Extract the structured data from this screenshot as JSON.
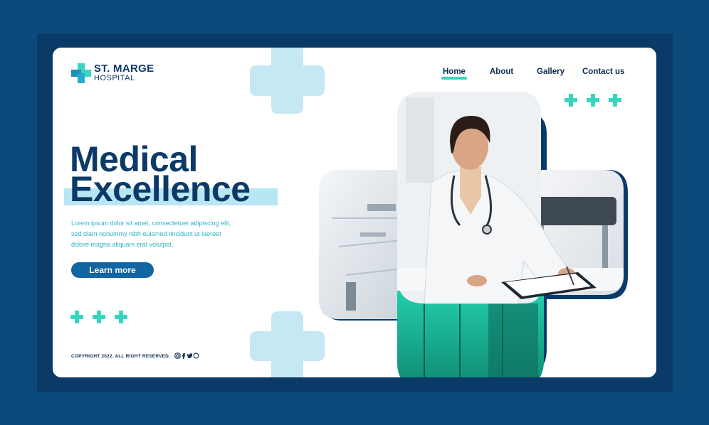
{
  "brand": {
    "name": "ST. MARGE",
    "subtitle": "HOSPITAL"
  },
  "nav": {
    "items": [
      {
        "label": "Home",
        "active": true
      },
      {
        "label": "About"
      },
      {
        "label": "Gallery"
      },
      {
        "label": "Contact us"
      }
    ]
  },
  "hero": {
    "title_line1": "Medical",
    "title_line2": "Excellence",
    "description_lines": [
      "Lorem ipsum dolor sit amet, consectetuer adipiscing elit,",
      "sed diam nonummy nibh euismod tincidunt ut laoreet",
      "dolore magna aliquam erat volutpat."
    ],
    "cta_label": "Learn more"
  },
  "footer": {
    "copyright": "COPYRIGHT 2022. ALL RIGHT RESERVED.",
    "social_icons": [
      "instagram-icon",
      "facebook-icon",
      "twitter-icon",
      "whatsapp-icon"
    ]
  },
  "colors": {
    "page_bg": "#0d4a7c",
    "frame": "#0b3a68",
    "navy": "#0b3a68",
    "teal": "#39d6bf",
    "light_blue": "#c5e8f4",
    "button": "#1265a3"
  }
}
